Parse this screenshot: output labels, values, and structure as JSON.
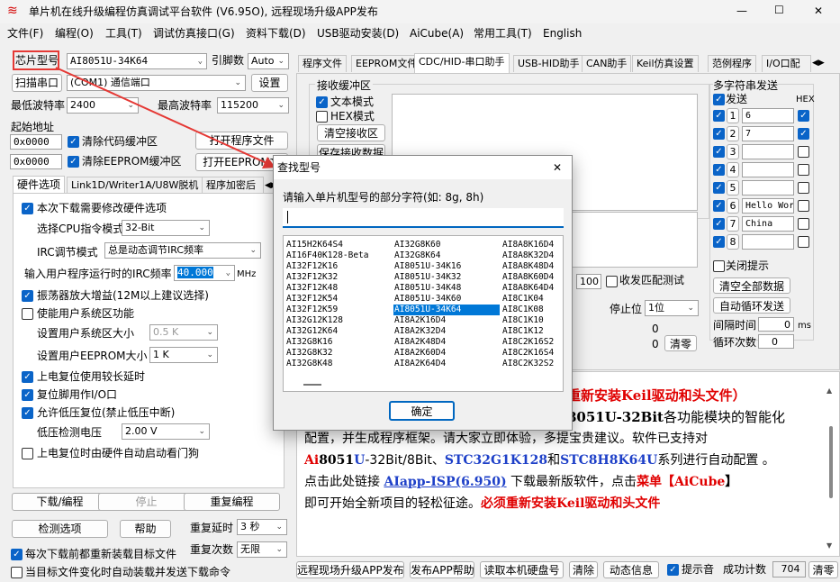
{
  "window": {
    "title": "单片机在线升级编程仿真调试平台软件 (V6.95O), 远程现场升级APP发布",
    "min": "—",
    "max": "☐",
    "close": "✕"
  },
  "menu": [
    "文件(F)",
    "编程(O)",
    "工具(T)",
    "调试仿真接口(G)",
    "资料下载(D)",
    "USB驱动安装(D)",
    "AiCube(A)",
    "常用工具(T)",
    "English"
  ],
  "left": {
    "chip_label": "芯片型号",
    "chip_value": "AI8051U-34K64",
    "pins_label": "引脚数",
    "pins_value": "Auto",
    "scan_label": "扫描串口",
    "port_value": "(COM1) 通信端口",
    "settings": "设置",
    "min_baud_label": "最低波特率",
    "min_baud": "2400",
    "max_baud_label": "最高波特率",
    "max_baud": "115200",
    "start_addr": "起始地址",
    "addr1": "0x0000",
    "clear_code": "清除代码缓冲区",
    "open_prog": "打开程序文件",
    "addr2": "0x0000",
    "clear_eeprom": "清除EEPROM缓冲区",
    "open_eeprom": "打开EEPROM文",
    "tabs": [
      "硬件选项",
      "Link1D/Writer1A/U8W脱机",
      "程序加密后"
    ],
    "opts": {
      "o1": "本次下载需要修改硬件选项",
      "cpu_mode_label": "选择CPU指令模式",
      "cpu_mode": "32-Bit",
      "irc_label": "IRC调节模式",
      "irc_value": "总是动态调节IRC频率",
      "freq_label": "输入用户程序运行时的IRC频率",
      "freq_value": "40.000",
      "mhz": "MHz",
      "o2": "振荡器放大增益(12M以上建议选择)",
      "o3": "使能用户系统区功能",
      "sys_size_label": "设置用户系统区大小",
      "sys_size": "0.5 K",
      "ee_size_label": "设置用户EEPROM大小",
      "ee_size": "1    K",
      "o4": "上电复位使用较长延时",
      "o5": "复位脚用作I/O口",
      "o6": "允许低压复位(禁止低压中断)",
      "lv_label": "低压检测电压",
      "lv_value": "2.00 V",
      "o7": "上电复位时由硬件自动启动看门狗"
    },
    "download": "下载/编程",
    "stop": "停止",
    "reprogram": "重复编程",
    "detect": "检测选项",
    "help": "帮助",
    "delay_label": "重复延时",
    "delay_value": "3 秒",
    "count_label": "重复次数",
    "count_value": "无限",
    "reload": "每次下载前都重新装载目标文件",
    "auto_send": "当目标文件变化时自动装载并发送下载命令"
  },
  "right": {
    "tabs": [
      "程序文件",
      "EEPROM文件",
      "CDC/HID-串口助手",
      "USB-HID助手",
      "CAN助手",
      "Keil仿真设置",
      "范例程序",
      "I/O口配"
    ],
    "recv_title": "接收缓冲区",
    "text_mode": "文本模式",
    "hex_mode": "HEX模式",
    "clear_recv": "清空接收区",
    "save_recv": "保存接收数据",
    "multi_title": "多字符串发送",
    "send": "发送",
    "hex": "HEX",
    "multi": [
      {
        "n": "1",
        "v": "6"
      },
      {
        "n": "2",
        "v": "7"
      },
      {
        "n": "3",
        "v": ""
      },
      {
        "n": "4",
        "v": ""
      },
      {
        "n": "5",
        "v": ""
      },
      {
        "n": "6",
        "v": "Hello Wor"
      },
      {
        "n": "7",
        "v": "China"
      },
      {
        "n": "8",
        "v": ""
      }
    ],
    "close_tip": "关闭提示",
    "clear_all": "清空全部数据",
    "auto_loop": "自动循环发送",
    "interval": "间隔时间",
    "interval_v": "0",
    "ms": "ms",
    "loops": "循环次数",
    "loops_v": "0",
    "v100": "100",
    "match": "收发匹配测试",
    "stopbit": "停止位",
    "stopbit_v": "1位",
    "z1": "0",
    "z2": "0",
    "clear": "清零",
    "notice": {
      "l1": "重新安装Keil驱动和头文件）",
      "l2a": "8051U-32Bit",
      "l2b": "各功能模块的智能化",
      "l3": "配置，并生成程序框架。请大家立即体验，多提宝贵建议。软件已支持对",
      "l4a": "Ai",
      "l4b": "8051",
      "l4c": "U",
      "l4d": "-32Bit/8Bit、",
      "l4e": "STC32G1K128",
      "l4f": "和",
      "l4g": "STC8H8K64U",
      "l4h": "系列进行自动配置 。",
      "l5a": "点击此处链接 ",
      "l5b": "AIapp-ISP(6.950)",
      "l5c": " 下载最新版软件，点击",
      "l5d": "菜单【",
      "l5e": "AiCube",
      "l5f": "】",
      "l6a": "即可开始全新项目的轻松征途。",
      "l6b": "必须重新安装Keil驱动和头文件"
    },
    "bottom": [
      "远程现场升级APP发布",
      "发布APP帮助",
      "读取本机硬盘号",
      "清除",
      "动态信息"
    ],
    "beep": "提示音",
    "success_label": "成功计数",
    "success_v": "704",
    "clear2": "清零"
  },
  "dialog": {
    "title": "查找型号",
    "close": "✕",
    "prompt": "请输入单片机型号的部分字符(如: 8g, 8h)",
    "ok": "确定",
    "cols": [
      [
        "AI15H2K64S4",
        "AI16F40K128-Beta",
        "AI32F12K16",
        "AI32F12K32",
        "AI32F12K48",
        "AI32F12K54",
        "AI32F12K59",
        "AI32G12K128",
        "AI32G12K64",
        "AI32G8K16",
        "AI32G8K32",
        "AI32G8K48"
      ],
      [
        "AI32G8K60",
        "AI32G8K64",
        "AI8051U-34K16",
        "AI8051U-34K32",
        "AI8051U-34K48",
        "AI8051U-34K60",
        "AI8051U-34K64",
        "AI8A2K16D4",
        "AI8A2K32D4",
        "AI8A2K48D4",
        "AI8A2K60D4",
        "AI8A2K64D4"
      ],
      [
        "AI8A8K16D4",
        "AI8A8K32D4",
        "AI8A8K48D4",
        "AI8A8K60D4",
        "AI8A8K64D4",
        "AI8C1K04",
        "AI8C1K08",
        "AI8C1K10",
        "AI8C1K12",
        "AI8C2K16S2",
        "AI8C2K16S4",
        "AI8C2K32S2"
      ]
    ],
    "selected": "AI8051U-34K64"
  }
}
